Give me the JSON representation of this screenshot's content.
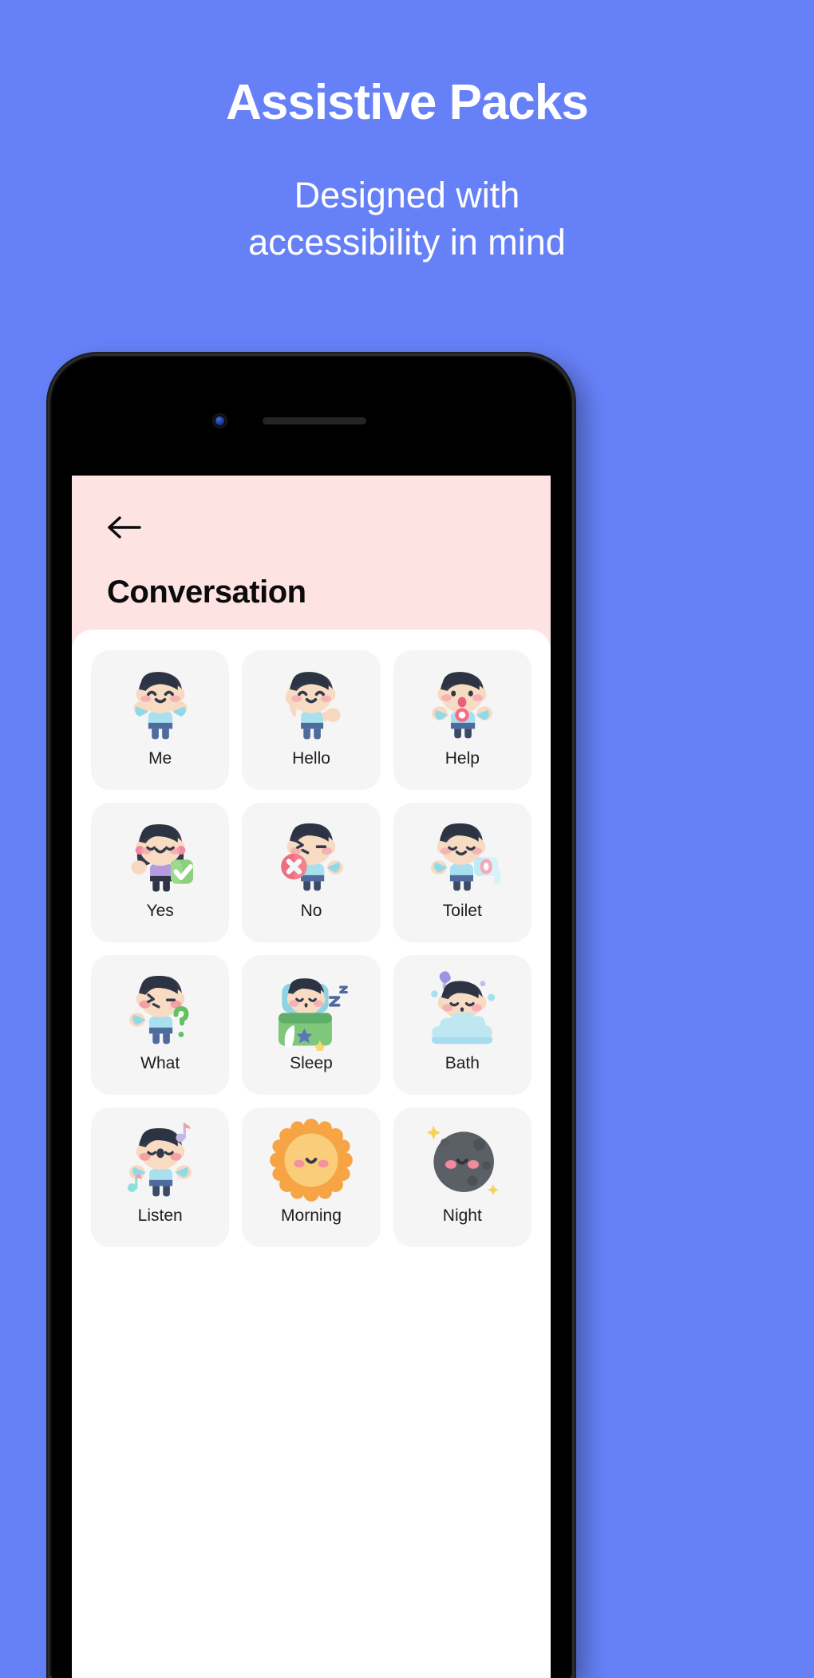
{
  "promo": {
    "title": "Assistive Packs",
    "subtitle_line1": "Designed with",
    "subtitle_line2": "accessibility in mind",
    "background_color": "#6680f7",
    "text_color": "#ffffff"
  },
  "device": {
    "frame_color": "#0a0a0a",
    "camera_icon": "front-camera-icon",
    "speaker_icon": "earpiece-speaker-icon"
  },
  "app": {
    "header": {
      "back_label": "Back",
      "back_icon": "arrow-left-icon",
      "title": "Conversation",
      "background_color": "#fde3e2",
      "title_color": "#0b0b0b"
    },
    "tile_background": "#f5f5f5",
    "grid": {
      "columns": 3,
      "items": [
        {
          "label": "Me",
          "art": "kid-arms-open"
        },
        {
          "label": "Hello",
          "art": "kid-waving"
        },
        {
          "label": "Help",
          "art": "kid-calling-help"
        },
        {
          "label": "Yes",
          "art": "girl-check"
        },
        {
          "label": "No",
          "art": "kid-cross"
        },
        {
          "label": "Toilet",
          "art": "kid-toilet-paper"
        },
        {
          "label": "What",
          "art": "kid-question"
        },
        {
          "label": "Sleep",
          "art": "kid-sleeping"
        },
        {
          "label": "Bath",
          "art": "kid-bath"
        },
        {
          "label": "Listen",
          "art": "kid-music-notes"
        },
        {
          "label": "Morning",
          "art": "sun-face"
        },
        {
          "label": "Night",
          "art": "moon-face"
        }
      ]
    }
  }
}
